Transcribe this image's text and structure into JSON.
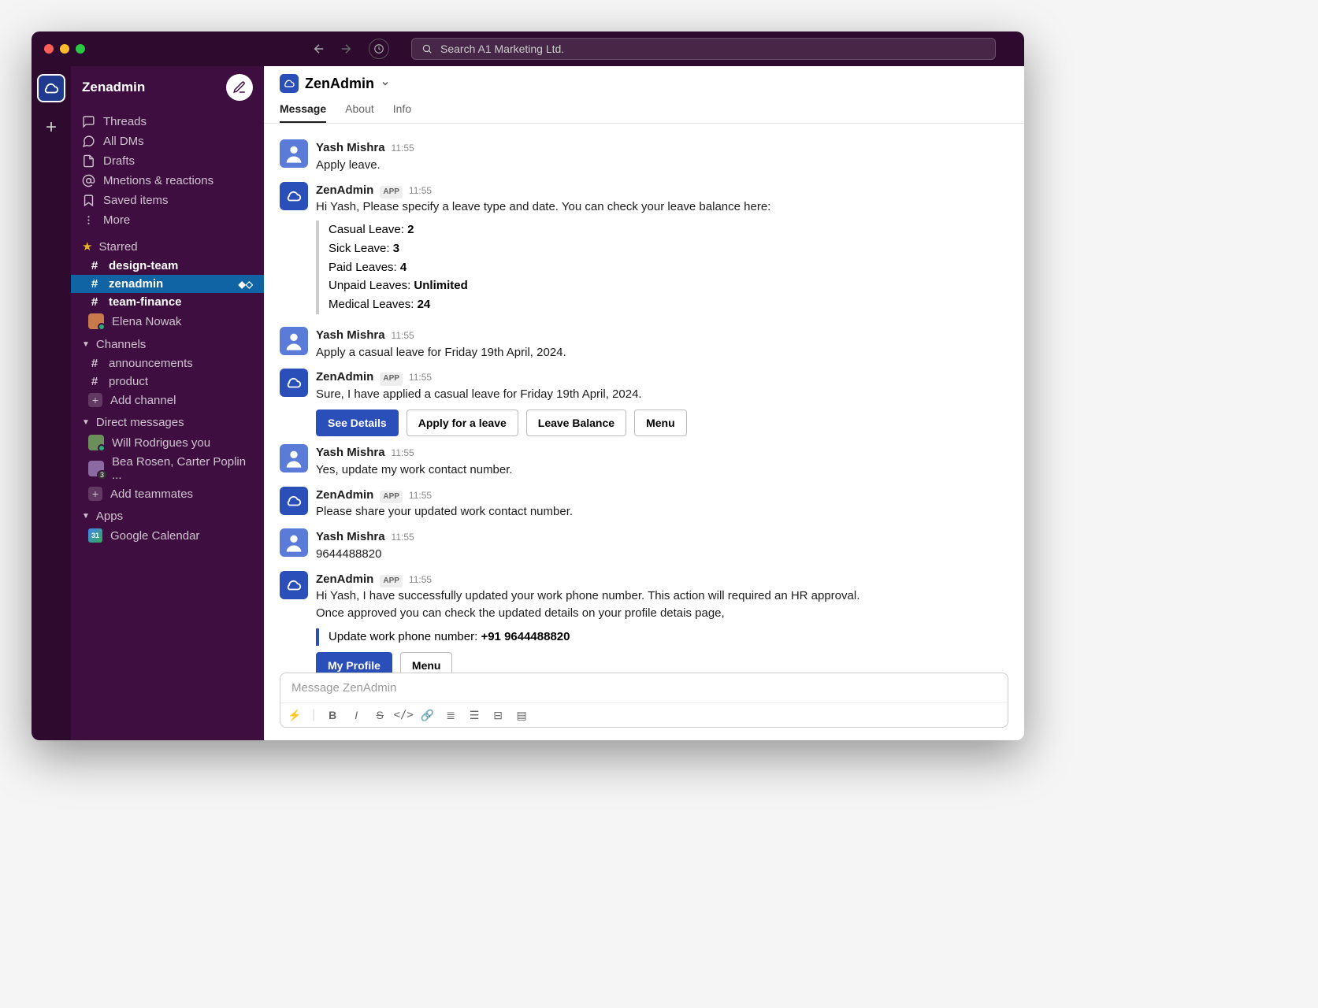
{
  "workspace": "Zenadmin",
  "search_placeholder": "Search A1 Marketing Ltd.",
  "sidebar": {
    "nav": {
      "threads": "Threads",
      "all_dms": "All DMs",
      "drafts": "Drafts",
      "mentions": "Mnetions & reactions",
      "saved": "Saved items",
      "more": "More"
    },
    "starred": {
      "label": "Starred",
      "items": [
        "design-team",
        "zenadmin",
        "team-finance"
      ],
      "person": "Elena Nowak"
    },
    "channels": {
      "label": "Channels",
      "items": [
        "announcements",
        "product"
      ],
      "add": "Add channel"
    },
    "dms": {
      "label": "Direct messages",
      "items": [
        "Will Rodrigues you",
        "Bea Rosen, Carter Poplin ..."
      ],
      "badge": "3",
      "add": "Add teammates"
    },
    "apps": {
      "label": "Apps",
      "items": [
        "Google Calendar"
      ]
    }
  },
  "channel": {
    "title": "ZenAdmin",
    "tabs": {
      "message": "Message",
      "about": "About",
      "info": "Info"
    }
  },
  "messages": {
    "m1": {
      "name": "Yash Mishra",
      "time": "11:55",
      "text": "Apply leave."
    },
    "m2": {
      "name": "ZenAdmin",
      "badge": "APP",
      "time": "11:55",
      "text": "Hi Yash, Please specify a leave type and date. You can check your leave balance here:",
      "balances": {
        "casual_label": "Casual Leave: ",
        "casual_val": "2",
        "sick_label": "Sick Leave: ",
        "sick_val": "3",
        "paid_label": "Paid Leaves: ",
        "paid_val": "4",
        "unpaid_label": "Unpaid Leaves: ",
        "unpaid_val": "Unlimited",
        "medical_label": "Medical Leaves: ",
        "medical_val": "24"
      }
    },
    "m3": {
      "name": "Yash Mishra",
      "time": "11:55",
      "text": "Apply a casual leave for Friday 19th April, 2024."
    },
    "m4": {
      "name": "ZenAdmin",
      "badge": "APP",
      "time": "11:55",
      "text": "Sure, I have applied a casual leave for Friday 19th April, 2024.",
      "buttons": {
        "see": "See Details",
        "apply": "Apply for a leave",
        "balance": "Leave Balance",
        "menu": "Menu"
      }
    },
    "m5": {
      "name": "Yash Mishra",
      "time": "11:55",
      "text": "Yes, update my work contact number."
    },
    "m6": {
      "name": "ZenAdmin",
      "badge": "APP",
      "time": "11:55",
      "text": "Please share your updated work contact number."
    },
    "m7": {
      "name": "Yash Mishra",
      "time": "11:55",
      "text": "9644488820"
    },
    "m8": {
      "name": "ZenAdmin",
      "badge": "APP",
      "time": "11:55",
      "text1": "Hi Yash, I have successfully updated your work phone number. This action will required an HR approval.",
      "text2": "Once approved you can check the updated details on your profile detais page,",
      "update_label": "Update work phone number: ",
      "update_val": "+91 9644488820",
      "buttons": {
        "profile": "My Profile",
        "menu": "Menu"
      }
    }
  },
  "composer": {
    "placeholder": "Message ZenAdmin"
  }
}
